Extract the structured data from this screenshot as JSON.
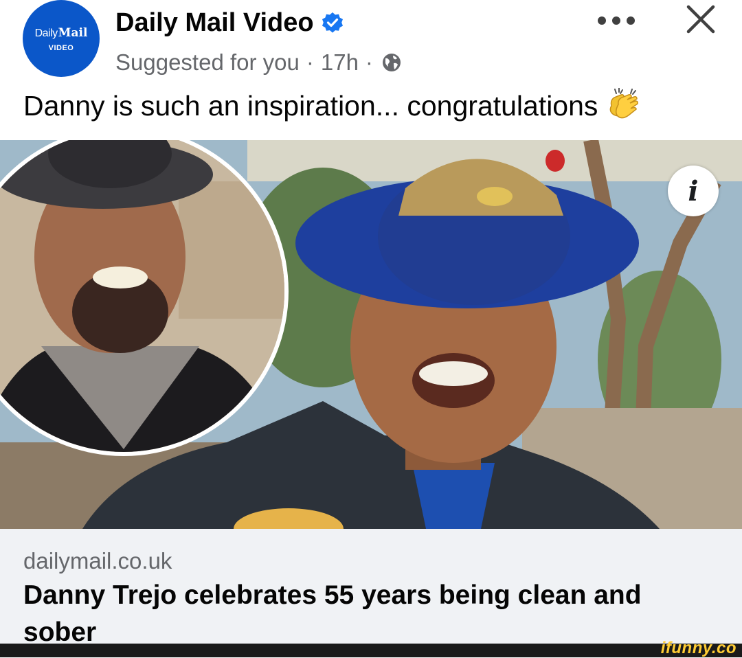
{
  "post": {
    "page_name": "Daily Mail Video",
    "avatar": {
      "logo_daily": "Daily",
      "logo_mail": "Mail",
      "logo_sub": "VIDEO"
    },
    "meta": {
      "suggested": "Suggested for you",
      "separator": "·",
      "time": "17h"
    },
    "caption": "Danny is such an inspiration... congratulations"
  },
  "link_preview": {
    "domain": "dailymail.co.uk",
    "headline": "Danny Trejo celebrates 55 years being clean and sober"
  },
  "watermark": "ifunny.co",
  "icons": {
    "verified": "verified-badge-icon",
    "audience": "globe-icon",
    "more": "more-options-icon",
    "close": "close-icon",
    "emoji": "clapping-hands-icon",
    "info": "info-icon"
  },
  "colors": {
    "brand_blue": "#0b57c9",
    "verified_blue": "#1877f2",
    "secondary_text": "#65676b",
    "link_box_bg": "#f0f2f5",
    "watermark": "#ffcc33"
  }
}
